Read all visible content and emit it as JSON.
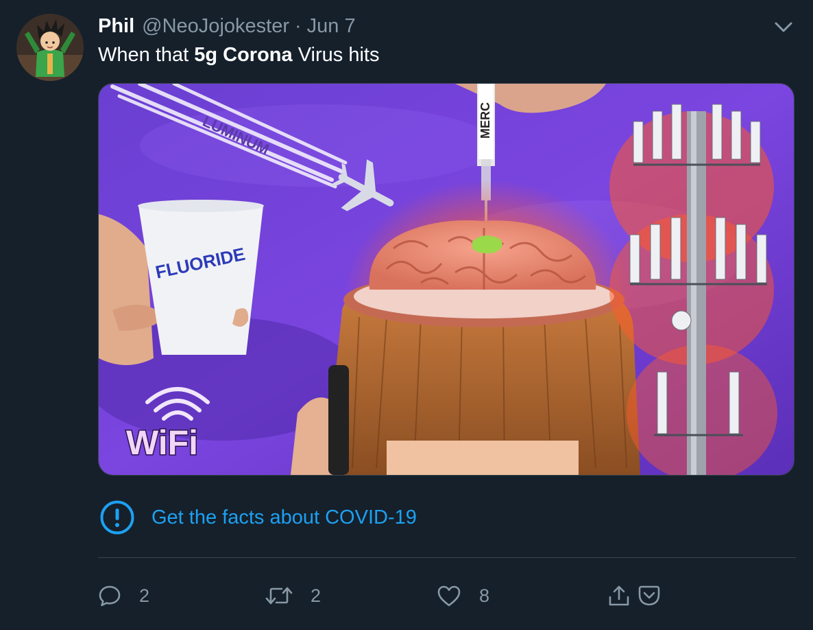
{
  "tweet": {
    "author": {
      "name": "Phil",
      "handle": "@NeoJojokester",
      "separator": "·",
      "date": "Jun 7"
    },
    "text_parts": [
      "When that ",
      "5g Corona",
      " Virus hits"
    ],
    "media": {
      "labels": {
        "trail": "LUMINUM",
        "syringe": "MERC",
        "cup": "FLUORIDE",
        "wifi": "WiFi"
      }
    },
    "notice": {
      "link_text": "Get the facts about COVID-19"
    },
    "actions": {
      "reply_count": "2",
      "retweet_count": "2",
      "like_count": "8"
    }
  },
  "icons": {
    "more": "chevron-down-icon",
    "notice": "exclamation-circle-icon",
    "reply": "speech-bubble-icon",
    "retweet": "retweet-arrows-icon",
    "like": "heart-icon",
    "share": "share-upload-icon",
    "pocket": "pocket-icon"
  },
  "colors": {
    "background": "#15202b",
    "link": "#1da1f2",
    "muted": "#8899a6",
    "divider": "#38444d",
    "text": "#ffffff"
  }
}
